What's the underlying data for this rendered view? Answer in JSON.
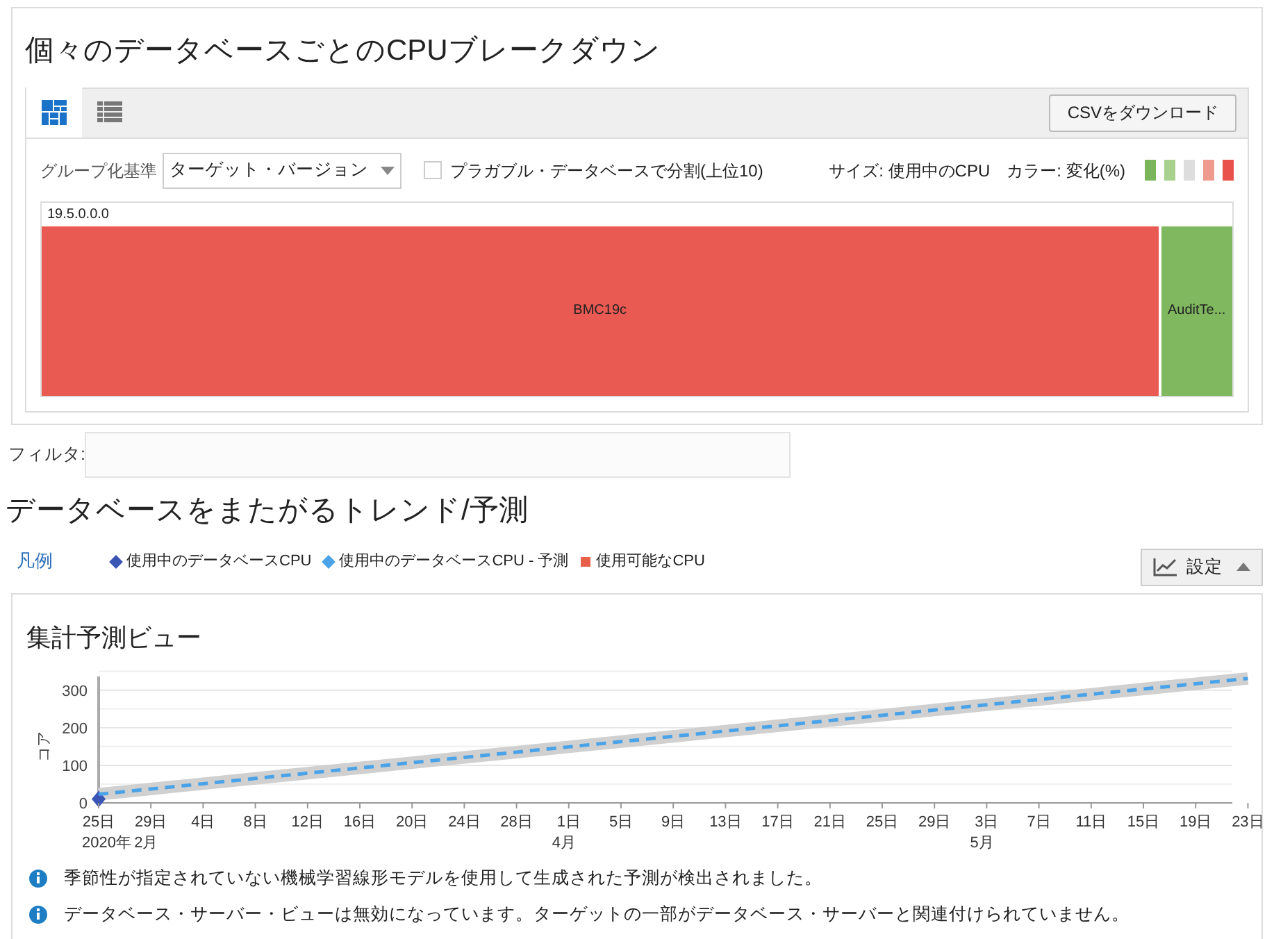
{
  "breakdown": {
    "title": "個々のデータベースごとのCPUブレークダウン",
    "view_tabs": [
      {
        "kind": "treemap",
        "selected": true
      },
      {
        "kind": "table",
        "selected": false
      }
    ],
    "download_button": "CSVをダウンロード",
    "group_by": {
      "label": "グループ化基準",
      "value": "ターゲット・バージョン"
    },
    "split_pluggable": {
      "label": "プラガブル・データベースで分割(上位10)",
      "checked": false
    },
    "size_label": "サイズ: 使用中のCPU",
    "color_label": "カラー: 変化(%)",
    "color_scale": [
      {
        "color": "#7ab55c"
      },
      {
        "color": "#a9d18e"
      },
      {
        "color": "#dddddd"
      },
      {
        "color": "#ee9a8f"
      },
      {
        "color": "#e8524a"
      }
    ],
    "treemap": {
      "group": "19.5.0.0.0",
      "cells": [
        {
          "label": "BMC19c",
          "level": 0.94,
          "color": "#e85a52"
        },
        {
          "label": "AuditTe...",
          "level": 0.06,
          "color": "#80b860"
        }
      ]
    }
  },
  "filter": {
    "label": "フィルタ:"
  },
  "trend": {
    "title": "データベースをまたがるトレンド/予測",
    "legend_link": "凡例",
    "settings_button": "設定",
    "panel": {
      "title": "集計予測ビュー",
      "chart_data": {
        "type": "line",
        "ylabel": "コア",
        "grid": true,
        "categories": [
          "25日",
          "29日",
          "4日",
          "8日",
          "12日",
          "16日",
          "20日",
          "24日",
          "28日",
          "1日",
          "5日",
          "9日",
          "13日",
          "17日",
          "21日",
          "25日",
          "29日",
          "3日",
          "7日",
          "11日",
          "15日",
          "19日",
          "23日"
        ],
        "yticks": [
          0,
          100,
          200,
          300
        ],
        "ylim": [
          0,
          340
        ],
        "series": [
          {
            "name": "使用中のデータベースCPU",
            "color": "#3a55b4",
            "marker": "diamond",
            "values": [
              10,
              null,
              null,
              null,
              null,
              null,
              null,
              null,
              null,
              null,
              null,
              null,
              null,
              null,
              null,
              null,
              null,
              null,
              null,
              null,
              null,
              null,
              null
            ]
          },
          {
            "name": "使用中のデータベースCPU - 予測",
            "color": "#4aa3e8",
            "marker": "none",
            "line_style": "dashed",
            "values": [
              23,
              37,
              51,
              65,
              79,
              93,
              107,
              121,
              135,
              149,
              163,
              177,
              191,
              205,
              219,
              233,
              247,
              261,
              275,
              289,
              303,
              317,
              331
            ]
          },
          {
            "name": "使用可能なCPU",
            "color": "#e8604a",
            "marker": "square",
            "values": [
              null,
              null,
              null,
              null,
              null,
              null,
              null,
              null,
              null,
              null,
              null,
              null,
              null,
              null,
              null,
              null,
              null,
              null,
              null,
              null,
              null,
              null,
              null
            ]
          }
        ]
      },
      "axis_groups": [
        "2020年",
        "2月",
        "4月",
        "5月"
      ],
      "messages": [
        "季節性が指定されていない機械学習線形モデルを使用して生成された予測が検出されました。",
        "データベース・サーバー・ビューは無効になっています。ターゲットの一部がデータベース・サーバーと関連付けられていません。"
      ]
    }
  }
}
